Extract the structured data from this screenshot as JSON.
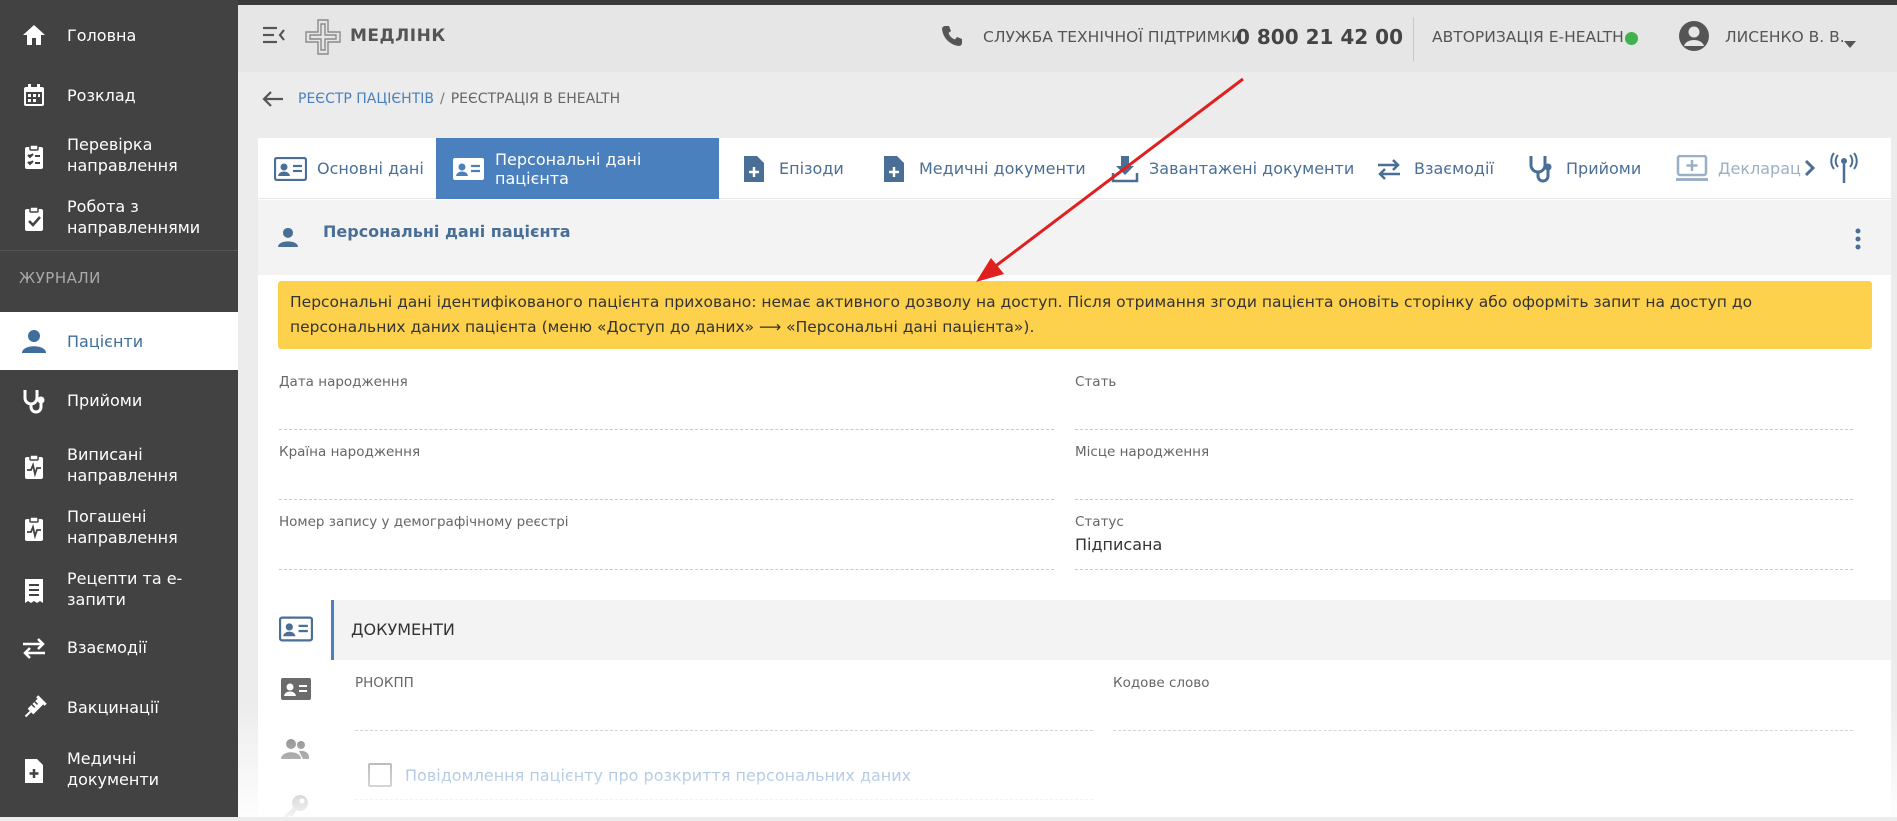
{
  "sidebar": {
    "items": [
      {
        "label": "Головна",
        "icon": "home-icon"
      },
      {
        "label": "Розклад",
        "icon": "calendar-icon"
      },
      {
        "label": "Перевірка направлення",
        "icon": "clipboard-check-icon"
      },
      {
        "label": "Робота з направленнями",
        "icon": "clipboard-check-icon"
      },
      {
        "label": "Пацієнти",
        "icon": "person-icon"
      },
      {
        "label": "Прийоми",
        "icon": "stethoscope-icon"
      },
      {
        "label": "Виписані направлення",
        "icon": "clipboard-pulse-icon"
      },
      {
        "label": "Погашені направлення",
        "icon": "clipboard-pulse-icon"
      },
      {
        "label": "Рецепти та е-запити",
        "icon": "receipt-icon"
      },
      {
        "label": "Взаємодії",
        "icon": "swap-icon"
      },
      {
        "label": "Вакцинації",
        "icon": "syringe-icon"
      },
      {
        "label": "Медичні документи",
        "icon": "medical-doc-icon"
      }
    ],
    "section_title": "ЖУРНАЛИ",
    "active_label": "Пацієнти"
  },
  "topbar": {
    "brand": "МЕДЛІНК",
    "support_label": "СЛУЖБА ТЕХНІЧНОЇ ПІДТРИМКИ",
    "support_phone": "0 800 21 42 00",
    "auth_label": "АВТОРИЗАЦІЯ E-HEALTH",
    "auth_status_color": "#3fb24f",
    "user_name": "ЛИСЕНКО В. В."
  },
  "breadcrumb": {
    "link": "РЕЄСТР ПАЦІЄНТІВ",
    "separator": "/",
    "current": "РЕЄСТРАЦІЯ В EHEALTH"
  },
  "tabs": [
    {
      "label": "Основні дані",
      "icon": "id-card-icon"
    },
    {
      "label": "Персональні дані пацієнта",
      "icon": "id-card-icon",
      "active": true
    },
    {
      "label": "Епізоди",
      "icon": "medical-file-icon"
    },
    {
      "label": "Медичні документи",
      "icon": "medical-file-icon"
    },
    {
      "label": "Завантажені документи",
      "icon": "download-icon"
    },
    {
      "label": "Взаємодії",
      "icon": "swap-icon"
    },
    {
      "label": "Прийоми",
      "icon": "stethoscope-icon"
    },
    {
      "label": "Декларації",
      "icon": "monitor-plus-icon"
    }
  ],
  "section": {
    "title": "Персональні дані пацієнта"
  },
  "warning": {
    "text": "Персональні дані ідентифікованого пацієнта приховано: немає активного дозволу на доступ. Після отримання згоди пацієнта оновіть сторінку або оформіть запит на доступ до персональних даних пацієнта (меню «Доступ до даних» ⟶ «Персональні дані пацієнта»).",
    "color": "#fdd14b"
  },
  "fields": {
    "birth_date": {
      "label": "Дата народження",
      "value": ""
    },
    "gender": {
      "label": "Стать",
      "value": ""
    },
    "birth_country": {
      "label": "Країна народження",
      "value": ""
    },
    "birth_place": {
      "label": "Місце народження",
      "value": ""
    },
    "demographic_record": {
      "label": "Номер запису у демографічному реєстрі",
      "value": ""
    },
    "status": {
      "label": "Статус",
      "value": "Підписана"
    }
  },
  "documents": {
    "title": "ДОКУМЕНТИ",
    "rnokpp_label": "РНОКПП",
    "code_word_label": "Кодове слово",
    "notify_checkbox_label": "Повідомлення пацієнту про розкриття персональних даних",
    "notify_checked": false
  },
  "colors": {
    "accent": "#4a80bd",
    "sidebar_bg": "#424242",
    "annotation_arrow": "#e0201f"
  }
}
